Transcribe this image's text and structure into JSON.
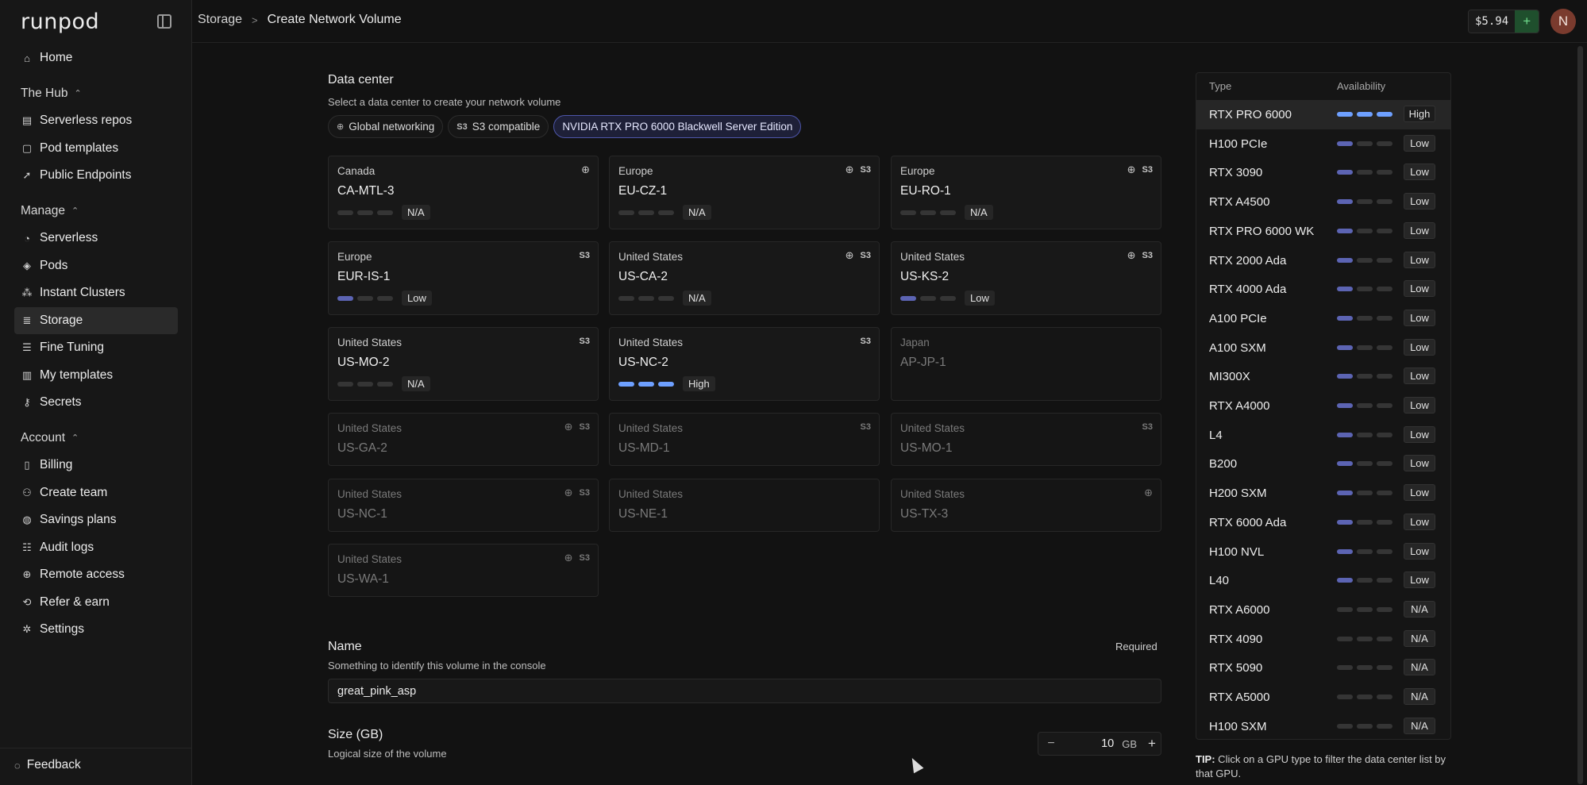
{
  "app": {
    "logo": "runpod"
  },
  "sidebar": {
    "top_items": [
      {
        "label": "Home",
        "icon": "home-icon"
      }
    ],
    "groups": [
      {
        "label": "The Hub",
        "items": [
          {
            "label": "Serverless repos",
            "icon": "repo-icon"
          },
          {
            "label": "Pod templates",
            "icon": "template-icon"
          },
          {
            "label": "Public Endpoints",
            "icon": "rocket-icon"
          }
        ]
      },
      {
        "label": "Manage",
        "items": [
          {
            "label": "Serverless",
            "icon": "serverless-icon"
          },
          {
            "label": "Pods",
            "icon": "cube-icon"
          },
          {
            "label": "Instant Clusters",
            "icon": "cluster-icon"
          },
          {
            "label": "Storage",
            "icon": "database-icon",
            "active": true
          },
          {
            "label": "Fine Tuning",
            "icon": "sliders-icon"
          },
          {
            "label": "My templates",
            "icon": "book-icon"
          },
          {
            "label": "Secrets",
            "icon": "key-icon"
          }
        ]
      },
      {
        "label": "Account",
        "items": [
          {
            "label": "Billing",
            "icon": "receipt-icon"
          },
          {
            "label": "Create team",
            "icon": "user-plus-icon"
          },
          {
            "label": "Savings plans",
            "icon": "piggy-bank-icon"
          },
          {
            "label": "Audit logs",
            "icon": "list-icon"
          },
          {
            "label": "Remote access",
            "icon": "globe-icon"
          },
          {
            "label": "Refer & earn",
            "icon": "share-icon"
          },
          {
            "label": "Settings",
            "icon": "gear-icon"
          }
        ]
      }
    ],
    "feedback": "Feedback"
  },
  "topbar": {
    "breadcrumb": [
      "Storage",
      "Create Network Volume"
    ],
    "balance": "$5.94",
    "avatar_initial": "N"
  },
  "datacenter": {
    "title": "Data center",
    "subtitle": "Select a data center to create your network volume",
    "filters": [
      {
        "label": "Global networking",
        "icon": "globe-icon",
        "selected": false
      },
      {
        "label": "S3 compatible",
        "icon_text": "S3",
        "selected": false
      },
      {
        "label": "NVIDIA RTX PRO 6000 Blackwell Server Edition",
        "selected": true
      }
    ],
    "centers": [
      {
        "region": "Canada",
        "code": "CA-MTL-3",
        "globe": true,
        "s3": false,
        "availability": "N/A",
        "bars": 0,
        "disabled": false
      },
      {
        "region": "Europe",
        "code": "EU-CZ-1",
        "globe": true,
        "s3": true,
        "availability": "N/A",
        "bars": 0,
        "disabled": false
      },
      {
        "region": "Europe",
        "code": "EU-RO-1",
        "globe": true,
        "s3": true,
        "availability": "N/A",
        "bars": 0,
        "disabled": false
      },
      {
        "region": "Europe",
        "code": "EUR-IS-1",
        "globe": false,
        "s3": true,
        "availability": "Low",
        "bars": 1,
        "disabled": false
      },
      {
        "region": "United States",
        "code": "US-CA-2",
        "globe": true,
        "s3": true,
        "availability": "N/A",
        "bars": 0,
        "disabled": false
      },
      {
        "region": "United States",
        "code": "US-KS-2",
        "globe": true,
        "s3": true,
        "availability": "Low",
        "bars": 1,
        "disabled": false
      },
      {
        "region": "United States",
        "code": "US-MO-2",
        "globe": false,
        "s3": true,
        "availability": "N/A",
        "bars": 0,
        "disabled": false
      },
      {
        "region": "United States",
        "code": "US-NC-2",
        "globe": false,
        "s3": true,
        "availability": "High",
        "bars": 3,
        "disabled": false
      },
      {
        "region": "Japan",
        "code": "AP-JP-1",
        "globe": false,
        "s3": false,
        "availability": null,
        "bars": 0,
        "disabled": true
      },
      {
        "region": "United States",
        "code": "US-GA-2",
        "globe": true,
        "s3": true,
        "availability": null,
        "bars": 0,
        "disabled": true
      },
      {
        "region": "United States",
        "code": "US-MD-1",
        "globe": false,
        "s3": true,
        "availability": null,
        "bars": 0,
        "disabled": true
      },
      {
        "region": "United States",
        "code": "US-MO-1",
        "globe": false,
        "s3": true,
        "availability": null,
        "bars": 0,
        "disabled": true
      },
      {
        "region": "United States",
        "code": "US-NC-1",
        "globe": true,
        "s3": true,
        "availability": null,
        "bars": 0,
        "disabled": true
      },
      {
        "region": "United States",
        "code": "US-NE-1",
        "globe": false,
        "s3": false,
        "availability": null,
        "bars": 0,
        "disabled": true
      },
      {
        "region": "United States",
        "code": "US-TX-3",
        "globe": true,
        "s3": false,
        "availability": null,
        "bars": 0,
        "disabled": true
      },
      {
        "region": "United States",
        "code": "US-WA-1",
        "globe": true,
        "s3": true,
        "availability": null,
        "bars": 0,
        "disabled": true
      }
    ]
  },
  "name": {
    "title": "Name",
    "subtitle": "Something to identify this volume in the console",
    "required": "Required",
    "value": "great_pink_asp"
  },
  "size": {
    "title": "Size (GB)",
    "subtitle": "Logical size of the volume",
    "value": "10",
    "unit": "GB"
  },
  "gpu_table": {
    "headers": [
      "Type",
      "Availability"
    ],
    "rows": [
      {
        "name": "RTX PRO 6000",
        "availability": "High",
        "bars": 3
      },
      {
        "name": "H100 PCIe",
        "availability": "Low",
        "bars": 1
      },
      {
        "name": "RTX 3090",
        "availability": "Low",
        "bars": 1
      },
      {
        "name": "RTX A4500",
        "availability": "Low",
        "bars": 1
      },
      {
        "name": "RTX PRO 6000 WK",
        "availability": "Low",
        "bars": 1
      },
      {
        "name": "RTX 2000 Ada",
        "availability": "Low",
        "bars": 1
      },
      {
        "name": "RTX 4000 Ada",
        "availability": "Low",
        "bars": 1
      },
      {
        "name": "A100 PCIe",
        "availability": "Low",
        "bars": 1
      },
      {
        "name": "A100 SXM",
        "availability": "Low",
        "bars": 1
      },
      {
        "name": "MI300X",
        "availability": "Low",
        "bars": 1
      },
      {
        "name": "RTX A4000",
        "availability": "Low",
        "bars": 1
      },
      {
        "name": "L4",
        "availability": "Low",
        "bars": 1
      },
      {
        "name": "B200",
        "availability": "Low",
        "bars": 1
      },
      {
        "name": "H200 SXM",
        "availability": "Low",
        "bars": 1
      },
      {
        "name": "RTX 6000 Ada",
        "availability": "Low",
        "bars": 1
      },
      {
        "name": "H100 NVL",
        "availability": "Low",
        "bars": 1
      },
      {
        "name": "L40",
        "availability": "Low",
        "bars": 1
      },
      {
        "name": "RTX A6000",
        "availability": "N/A",
        "bars": 0
      },
      {
        "name": "RTX 4090",
        "availability": "N/A",
        "bars": 0
      },
      {
        "name": "RTX 5090",
        "availability": "N/A",
        "bars": 0
      },
      {
        "name": "RTX A5000",
        "availability": "N/A",
        "bars": 0
      },
      {
        "name": "H100 SXM",
        "availability": "N/A",
        "bars": 0
      }
    ],
    "tip_label": "TIP:",
    "tip_text": " Click on a GPU type to filter the data center list by that GPU."
  },
  "colors": {
    "bar_low": "#5c64b3",
    "bar_high": "#6ea0ff",
    "bar_off": "#353535",
    "accent_green": "#1f4f2d"
  }
}
